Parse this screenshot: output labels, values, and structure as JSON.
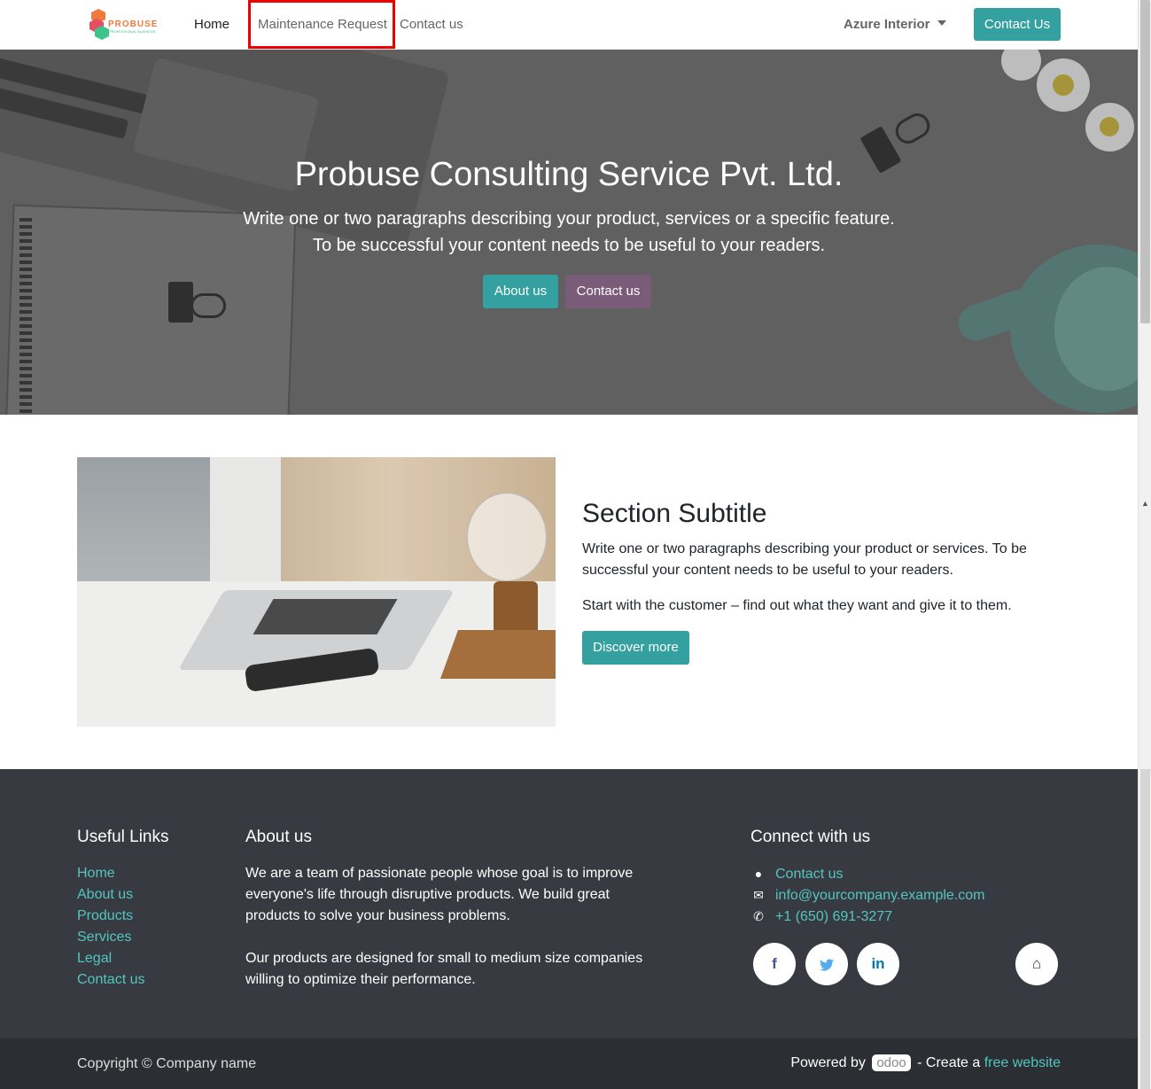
{
  "nav": {
    "logo_alt": "PROBUSE",
    "logo_sub": "PROFESSIONAL BUSINESS",
    "home": "Home",
    "maintenance": "Maintenance Request",
    "contact": "Contact us",
    "company": "Azure Interior",
    "cta": "Contact Us"
  },
  "hero": {
    "title": "Probuse Consulting Service Pvt. Ltd.",
    "line1": "Write one or two paragraphs describing your product, services or a specific feature.",
    "line2": "To be successful your content needs to be useful to your readers.",
    "btn_about": "About us",
    "btn_contact": "Contact us"
  },
  "section": {
    "title": "Section Subtitle",
    "p1": "Write one or two paragraphs describing your product or services. To be successful your content needs to be useful to your readers.",
    "p2": "Start with the customer – find out what they want and give it to them.",
    "btn": "Discover more"
  },
  "footer": {
    "links_title": "Useful Links",
    "links": [
      "Home",
      "About us",
      "Products",
      "Services",
      "Legal",
      "Contact us"
    ],
    "about_title": "About us",
    "about_p1": "We are a team of passionate people whose goal is to improve everyone's life through disruptive products. We build great products to solve your business problems.",
    "about_p2": "Our products are designed for small to medium size companies willing to optimize their performance.",
    "connect_title": "Connect with us",
    "connect_contact": "Contact us",
    "connect_email": "info@yourcompany.example.com",
    "connect_phone": "+1 (650) 691-3277",
    "social": {
      "facebook": "f",
      "twitter": "t",
      "linkedin": "in",
      "home": "⌂"
    }
  },
  "bottom": {
    "copyright": "Copyright © Company name",
    "powered_by": "Powered by",
    "odoo": "odoo",
    "create_a": "- Create a",
    "free_website": "free website"
  },
  "colors": {
    "accent": "#35a0a0",
    "secondary": "#7a5c79",
    "footer_bg": "#373b41",
    "link": "#53c5c0"
  }
}
